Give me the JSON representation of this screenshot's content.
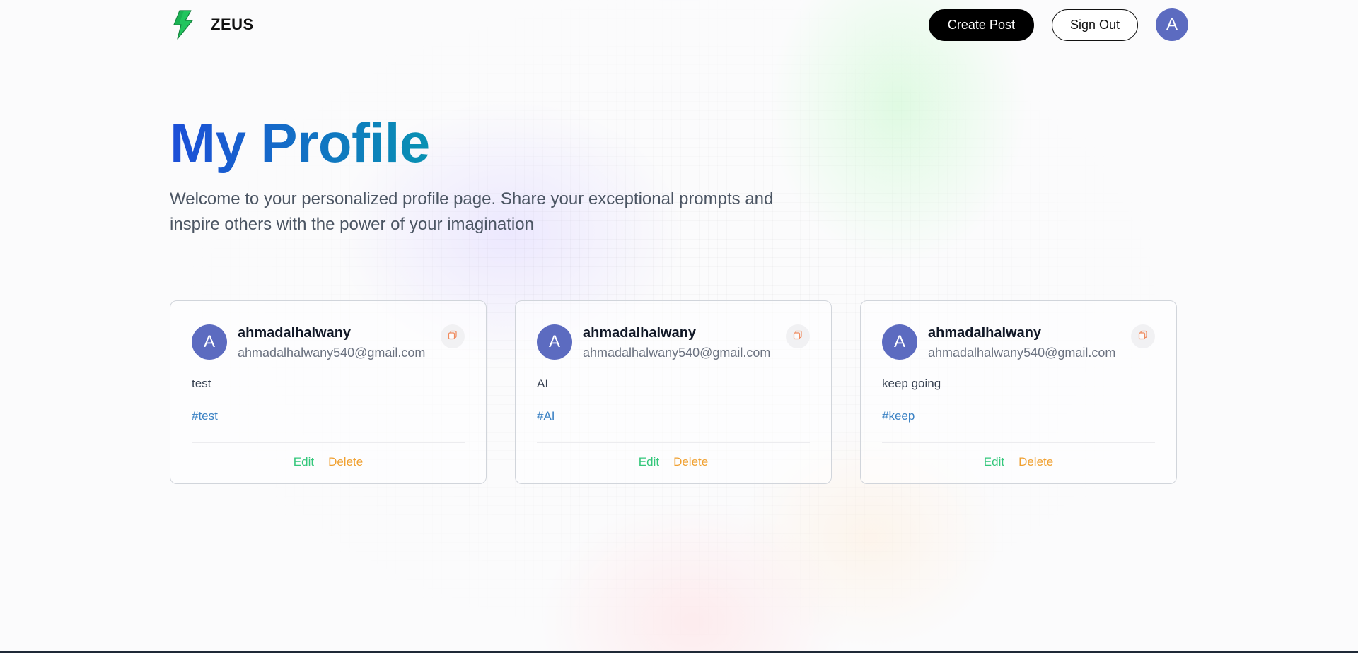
{
  "brand": {
    "name": "ZEUS",
    "logo_icon": "lightning-bolt-icon",
    "logo_color": "#22c55e"
  },
  "nav": {
    "create_post_label": "Create Post",
    "sign_out_label": "Sign Out",
    "avatar_initial": "A",
    "avatar_color": "#5c6bc0"
  },
  "hero": {
    "title": "My Profile",
    "description": "Welcome to your personalized profile page. Share your exceptional prompts and inspire others with the power of your imagination",
    "title_gradient": [
      "#1d4ed8",
      "#0891b2"
    ]
  },
  "posts": [
    {
      "avatar_initial": "A",
      "username": "ahmadalhalwany",
      "email": "ahmadalhalwany540@gmail.com",
      "prompt": "test",
      "tag": "#test",
      "edit_label": "Edit",
      "delete_label": "Delete",
      "copy_icon": "copy-icon"
    },
    {
      "avatar_initial": "A",
      "username": "ahmadalhalwany",
      "email": "ahmadalhalwany540@gmail.com",
      "prompt": "AI",
      "tag": "#AI",
      "edit_label": "Edit",
      "delete_label": "Delete",
      "copy_icon": "copy-icon"
    },
    {
      "avatar_initial": "A",
      "username": "ahmadalhalwany",
      "email": "ahmadalhalwany540@gmail.com",
      "prompt": "keep going",
      "tag": "#keep",
      "edit_label": "Edit",
      "delete_label": "Delete",
      "copy_icon": "copy-icon"
    }
  ],
  "colors": {
    "edit": "#34c77b",
    "delete": "#f0a030",
    "tag": "#3b82c4"
  }
}
